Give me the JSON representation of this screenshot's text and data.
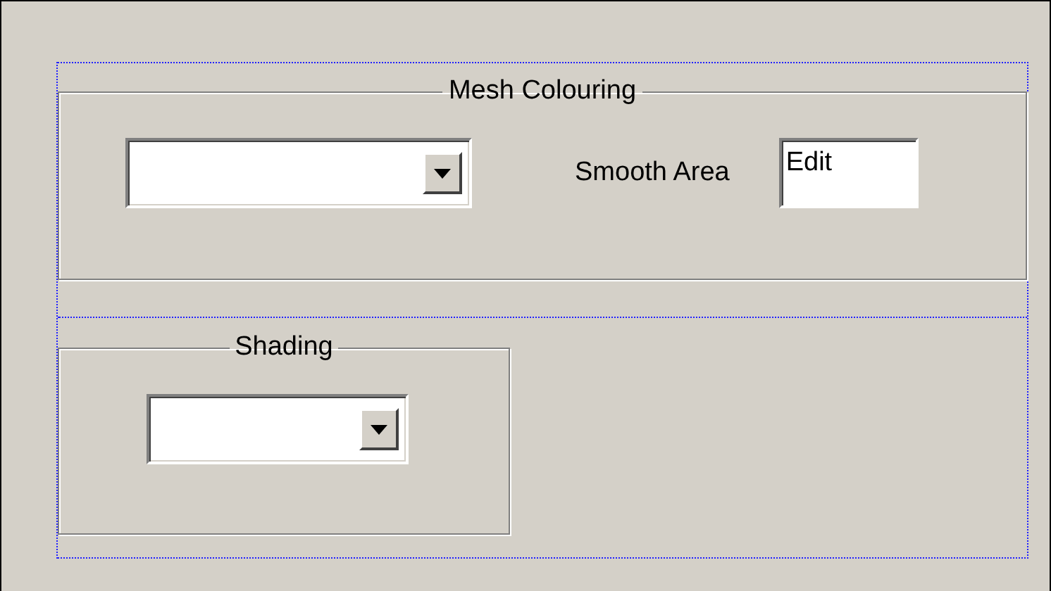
{
  "mesh_colouring": {
    "title": "Mesh Colouring",
    "label": "Smooth Area",
    "field": {
      "value": "Edit"
    }
  },
  "shading": {
    "title": "Shading"
  }
}
